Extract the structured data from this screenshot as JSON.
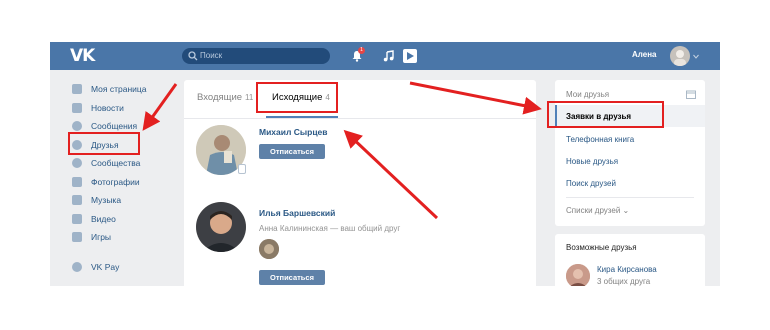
{
  "header": {
    "logo": "VK",
    "search_placeholder": "Поиск",
    "notification_count": "1",
    "username": "Алена"
  },
  "sidebar": {
    "items": [
      {
        "label": "Моя страница",
        "icon": "home-icon"
      },
      {
        "label": "Новости",
        "icon": "news-icon"
      },
      {
        "label": "Сообщения",
        "icon": "messages-icon"
      },
      {
        "label": "Друзья",
        "icon": "person-icon"
      },
      {
        "label": "Сообщества",
        "icon": "groups-icon"
      },
      {
        "label": "Фотографии",
        "icon": "camera-icon"
      },
      {
        "label": "Музыка",
        "icon": "music-icon"
      },
      {
        "label": "Видео",
        "icon": "video-icon"
      },
      {
        "label": "Игры",
        "icon": "gamepad-icon"
      }
    ],
    "vkpay": "VK Pay"
  },
  "main": {
    "tabs": [
      {
        "label": "Входящие",
        "count": "11"
      },
      {
        "label": "Исходящие",
        "count": "4"
      }
    ],
    "requests": [
      {
        "name": "Михаил Сырцев",
        "button": "Отписаться"
      },
      {
        "name": "Илья Баршевский",
        "mutual_name": "Анна Калининская",
        "mutual_text": "— ваш общий друг",
        "button": "Отписаться"
      }
    ]
  },
  "right": {
    "menu": [
      "Мои друзья",
      "Заявки в друзья",
      "Телефонная книга",
      "Новые друзья",
      "Поиск друзей"
    ],
    "lists": "Списки друзей",
    "possible_title": "Возможные друзья",
    "possible": [
      {
        "name": "Кира Кирсанова",
        "sub": "3 общих друга"
      }
    ]
  },
  "colors": {
    "header": "#4a76a8",
    "accent": "#5181b8",
    "highlight": "#e32020"
  }
}
